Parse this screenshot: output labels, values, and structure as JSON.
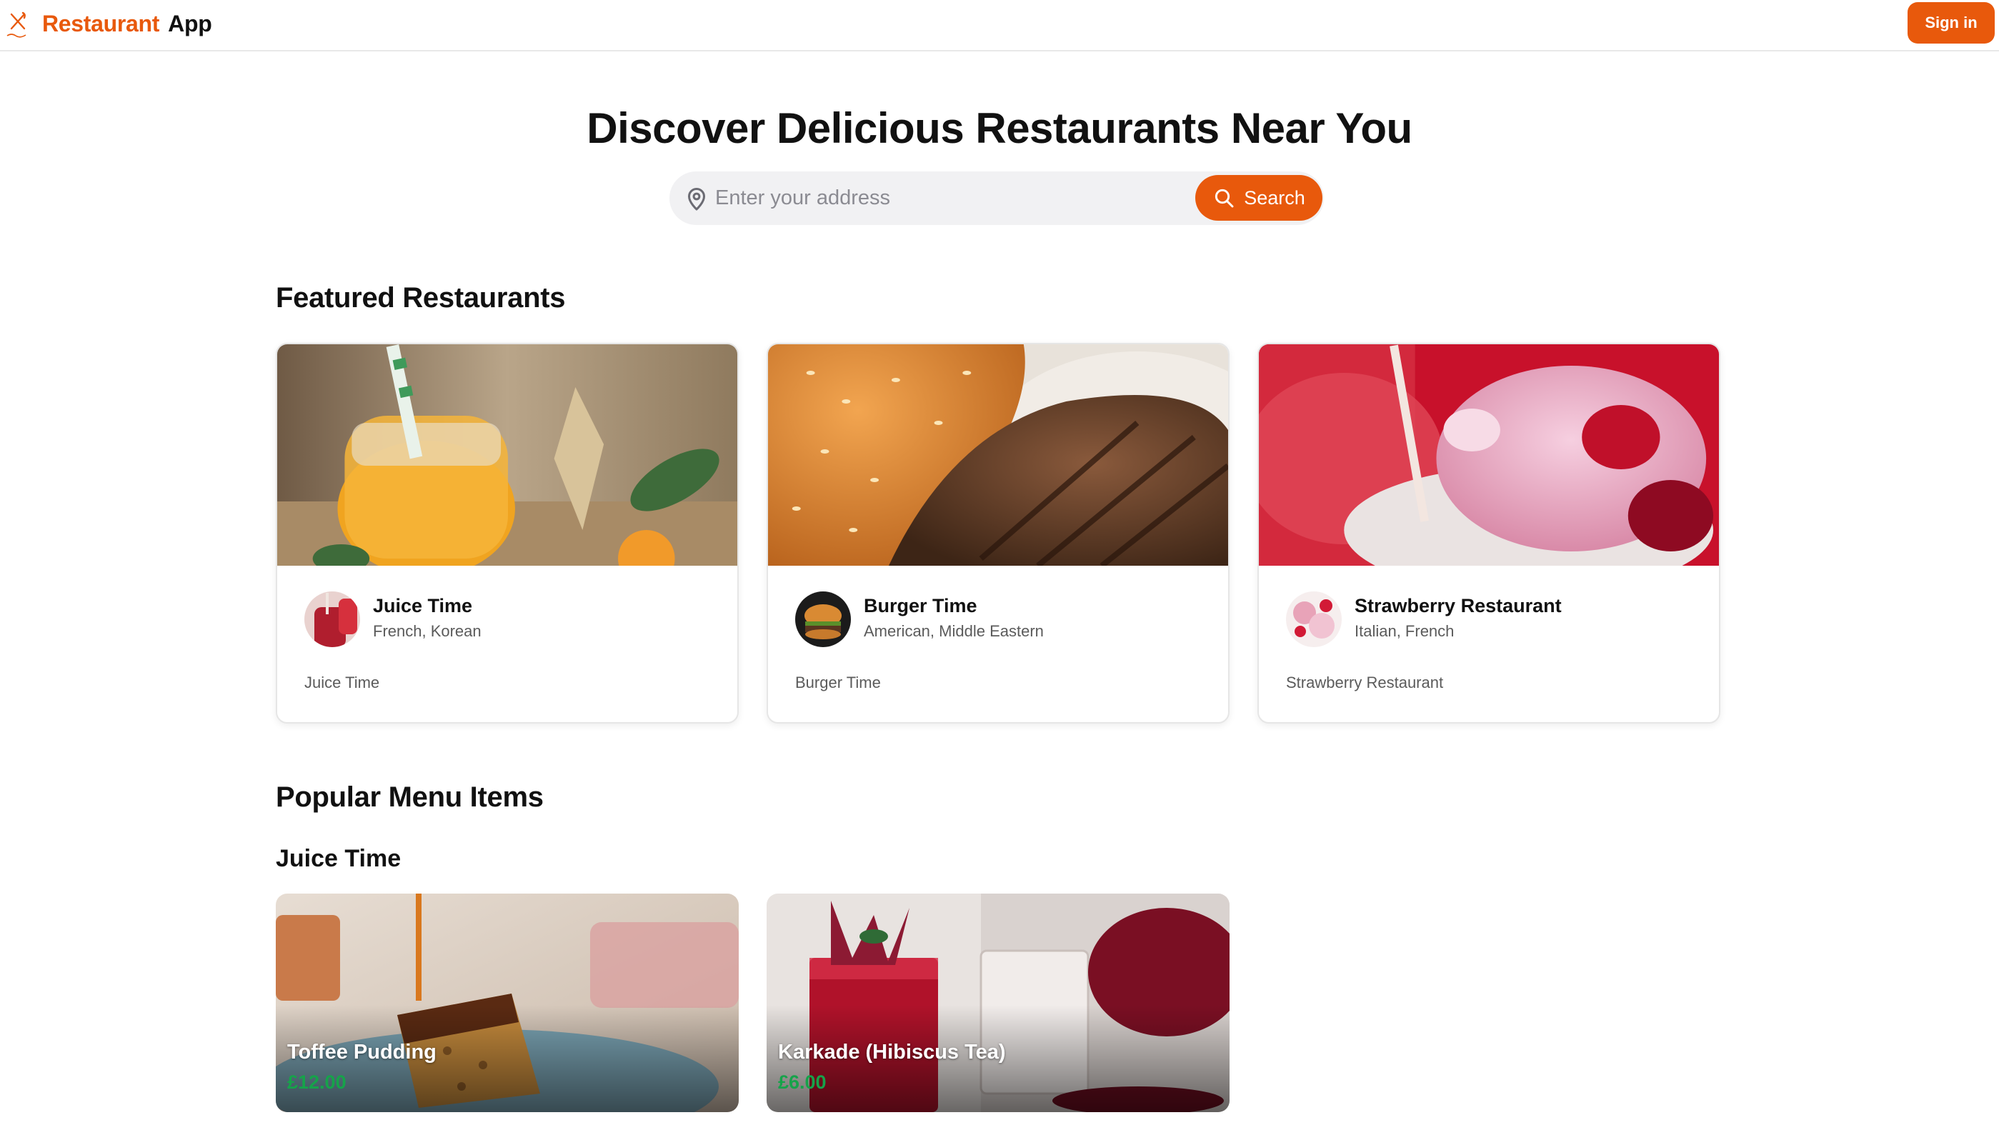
{
  "header": {
    "brand_accent": "Restaurant",
    "brand_rest": "App",
    "signin_label": "Sign in",
    "logo_icon": "fork-knife-logo-icon"
  },
  "hero": {
    "title": "Discover Delicious Restaurants Near You",
    "search": {
      "placeholder": "Enter your address",
      "value": "",
      "button_label": "Search",
      "pin_icon": "location-pin-icon",
      "button_icon": "search-icon"
    }
  },
  "featured": {
    "title": "Featured Restaurants",
    "restaurants": [
      {
        "name": "Juice Time",
        "cuisines": "French, Korean",
        "description": "Juice Time",
        "image": "juice-jar-photo"
      },
      {
        "name": "Burger Time",
        "cuisines": "American, Middle Eastern",
        "description": "Burger Time",
        "image": "burger-patty-photo"
      },
      {
        "name": "Strawberry Restaurant",
        "cuisines": "Italian, French",
        "description": "Strawberry Restaurant",
        "image": "strawberry-ice-cream-photo"
      }
    ]
  },
  "popular": {
    "title": "Popular Menu Items",
    "group_title": "Juice Time",
    "items": [
      {
        "name": "Toffee Pudding",
        "price": "£12.00",
        "image": "toffee-pudding-photo"
      },
      {
        "name": "Karkade (Hibiscus Tea)",
        "price": "£6.00",
        "image": "hibiscus-tea-photo"
      }
    ]
  },
  "colors": {
    "accent": "#e8590c",
    "price": "#16a34a",
    "search_bg": "#f1f1f3",
    "muted_text": "#5b5b5b"
  }
}
